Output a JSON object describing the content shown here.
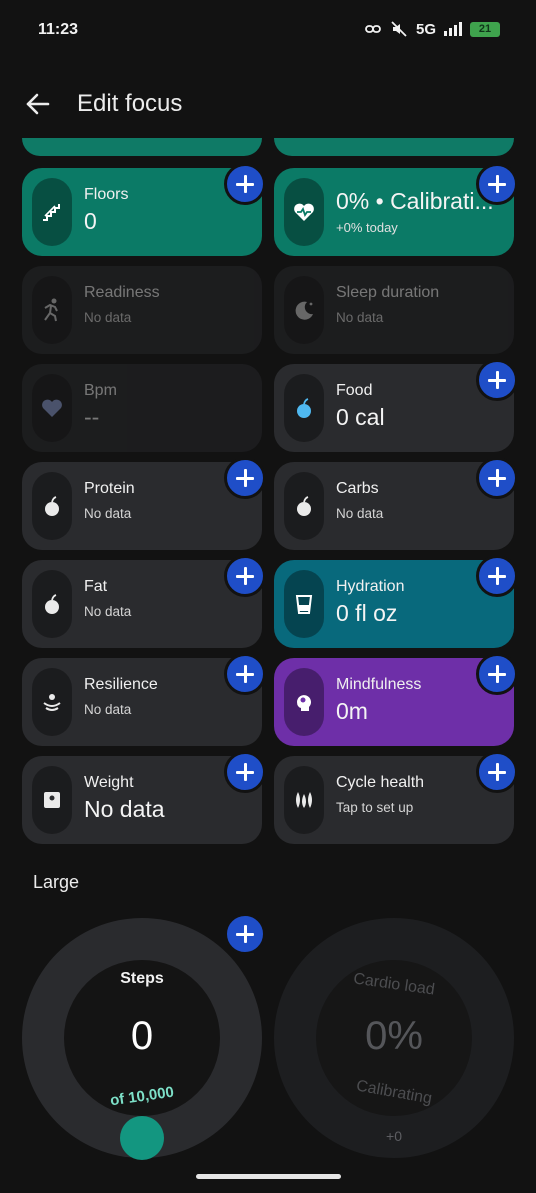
{
  "status_bar": {
    "time": "11:23",
    "network": "5G",
    "battery": "21"
  },
  "header": {
    "title": "Edit focus",
    "back_icon": "arrow-left-icon"
  },
  "cards": [
    {
      "id": "floors",
      "label": "Floors",
      "value": "0",
      "icon": "stairs-icon",
      "color": "#0b7a66",
      "added": false
    },
    {
      "id": "hrv",
      "label": "",
      "value": "0% • Calibrati...",
      "subtext": "+0% today",
      "icon": "heart-wave-icon",
      "color": "#0b7a66",
      "added": false
    },
    {
      "id": "readiness",
      "label": "Readiness",
      "subtext": "No data",
      "icon": "runner-icon",
      "disabled": true
    },
    {
      "id": "sleep",
      "label": "Sleep duration",
      "subtext": "No data",
      "icon": "moon-icon",
      "disabled": true
    },
    {
      "id": "bpm",
      "label": "Bpm",
      "value": "--",
      "icon": "heart-icon",
      "disabled": true
    },
    {
      "id": "food",
      "label": "Food",
      "value": "0 cal",
      "icon": "apple-icon"
    },
    {
      "id": "protein",
      "label": "Protein",
      "subtext": "No data",
      "icon": "apple-icon"
    },
    {
      "id": "carbs",
      "label": "Carbs",
      "subtext": "No data",
      "icon": "apple-icon"
    },
    {
      "id": "fat",
      "label": "Fat",
      "subtext": "No data",
      "icon": "apple-icon"
    },
    {
      "id": "hydration",
      "label": "Hydration",
      "value": "0 fl oz",
      "icon": "glass-icon",
      "color": "#08697c"
    },
    {
      "id": "resilience",
      "label": "Resilience",
      "subtext": "No data",
      "icon": "resilience-icon"
    },
    {
      "id": "mindfulness",
      "label": "Mindfulness",
      "value": "0m",
      "icon": "head-icon",
      "color": "#6e2fa8"
    },
    {
      "id": "weight",
      "label": "Weight",
      "value": "No data",
      "icon": "scale-icon"
    },
    {
      "id": "cycle",
      "label": "Cycle health",
      "subtext": "Tap to set up",
      "icon": "drops-icon"
    }
  ],
  "section_large": {
    "title": "Large"
  },
  "large": {
    "steps": {
      "label": "Steps",
      "value": "0",
      "goal": "of 10,000"
    },
    "cardio": {
      "label": "Cardio load",
      "value": "0%",
      "status": "Calibrating",
      "delta": "+0"
    }
  },
  "colors": {
    "add_button": "#1f4ec8",
    "card": "#2a2b2e",
    "background": "#121212"
  }
}
